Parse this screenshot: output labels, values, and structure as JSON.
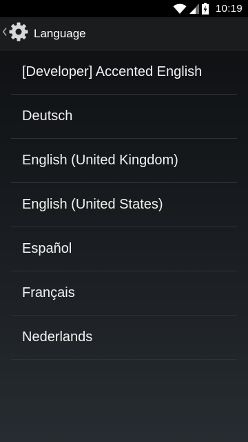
{
  "status_bar": {
    "time": "10:19",
    "icons": [
      "wifi-icon",
      "signal-icon",
      "battery-icon"
    ]
  },
  "action_bar": {
    "title": "Language",
    "icon": "settings-gear-icon",
    "back_icon": "chevron-left-icon"
  },
  "languages": [
    {
      "label": "[Developer] Accented English"
    },
    {
      "label": "Deutsch"
    },
    {
      "label": "English (United Kingdom)"
    },
    {
      "label": "English (United States)"
    },
    {
      "label": "Español"
    },
    {
      "label": "Français"
    },
    {
      "label": "Nederlands"
    }
  ],
  "colors": {
    "status_bar_bg": "#000000",
    "action_bar_bg": "#1b1c1e",
    "divider": "#2e3237",
    "text": "#f2f2f2"
  }
}
